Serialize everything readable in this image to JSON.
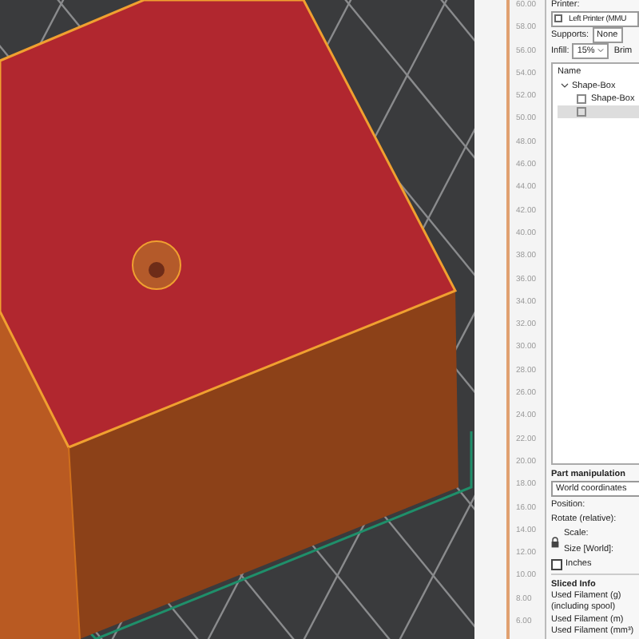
{
  "viewport": {
    "kind": "scene"
  },
  "layer_slider": {
    "labels": [
      "60.00",
      "58.00",
      "56.00",
      "54.00",
      "52.00",
      "50.00",
      "48.00",
      "46.00",
      "44.00",
      "42.00",
      "40.00",
      "38.00",
      "36.00",
      "34.00",
      "32.00",
      "30.00",
      "28.00",
      "26.00",
      "24.00",
      "22.00",
      "20.00",
      "18.00",
      "16.00",
      "14.00",
      "12.00",
      "10.00",
      "8.00",
      "6.00"
    ]
  },
  "sidebar": {
    "printer_label": "Printer:",
    "printer": "Left Printer (MMU",
    "supports_label": "Supports:",
    "supports": "None",
    "infill_label": "Infill:",
    "infill": "15%",
    "brim_label": "Brim",
    "object_list": {
      "header": "Name",
      "items": [
        {
          "label": "Shape-Box",
          "expanded": true,
          "selected": false,
          "children": [
            {
              "label": "Shape-Box",
              "selected": false
            },
            {
              "selected": true
            }
          ]
        }
      ]
    },
    "part_manipulation": {
      "title": "Part manipulation",
      "coordinates": "World coordinates",
      "position": "Position:",
      "rotate": "Rotate (relative):",
      "scale": "Scale:",
      "size": "Size [World]:",
      "inches_label": "Inches",
      "inches": false
    },
    "sliced_info": {
      "title": "Sliced Info",
      "rows": [
        "Used Filament (g)",
        "(including spool)",
        "Used Filament (m)",
        "Used Filament (mm³)"
      ]
    }
  }
}
